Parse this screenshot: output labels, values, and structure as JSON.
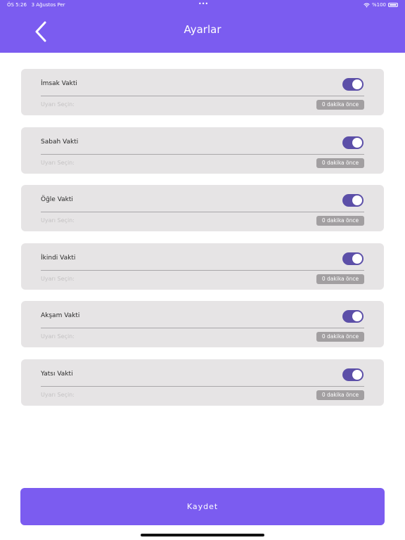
{
  "status_bar": {
    "time": "ÖS 5:26",
    "date": "3 Ağustos Per",
    "dots": "•••",
    "battery_text": "%100"
  },
  "header": {
    "title": "Ayarlar",
    "back_icon": "chevron-left-icon"
  },
  "prayers": [
    {
      "label": "İmsak Vakti",
      "enabled": true,
      "alert_label": "Uyarı Seçin:",
      "alert_value": "0 dakika önce"
    },
    {
      "label": "Sabah Vakti",
      "enabled": true,
      "alert_label": "Uyarı Seçin:",
      "alert_value": "0 dakika önce"
    },
    {
      "label": "Öğle Vakti",
      "enabled": true,
      "alert_label": "Uyarı Seçin:",
      "alert_value": "0 dakika önce"
    },
    {
      "label": "İkindi Vakti",
      "enabled": true,
      "alert_label": "Uyarı Seçin:",
      "alert_value": "0 dakika önce"
    },
    {
      "label": "Akşam Vakti",
      "enabled": true,
      "alert_label": "Uyarı Seçin:",
      "alert_value": "0 dakika önce"
    },
    {
      "label": "Yatsı Vakti",
      "enabled": true,
      "alert_label": "Uyarı Seçin:",
      "alert_value": "0 dakika önce"
    }
  ],
  "save_button": {
    "label": "Kaydet"
  },
  "colors": {
    "accent": "#7b5cf0",
    "toggle_on": "#5c4fa8",
    "card_bg": "#e6e4e5",
    "chip_bg": "#a29fa1"
  }
}
